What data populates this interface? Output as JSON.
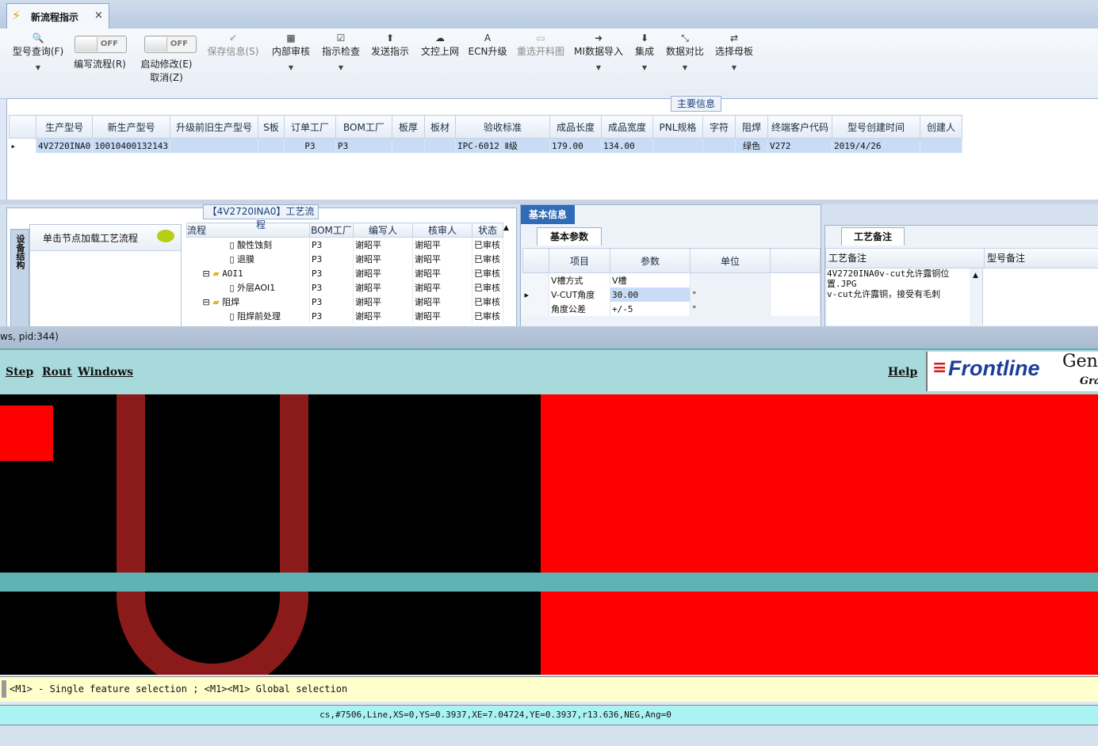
{
  "tab": {
    "title": "新流程指示",
    "close": "×"
  },
  "toolbar": {
    "query": "型号查询(F)",
    "write": "编写流程(R)",
    "start": "启动修改(E)",
    "cancel": "取消(Z)",
    "save": "保存信息(S)",
    "internal": "内部审核",
    "check": "指示检查",
    "send": "发送指示",
    "upload": "文控上网",
    "ecn": "ECN升级",
    "reselect": "重选开料图",
    "mi": "MI数据导入",
    "integrate": "集成",
    "compare": "数据对比",
    "master": "选择母板",
    "off": "OFF"
  },
  "main": {
    "group_title": "主要信息",
    "columns": [
      "生产型号",
      "新生产型号",
      "升级前旧生产型号",
      "S板",
      "订单工厂",
      "BOM工厂",
      "板厚",
      "板材",
      "验收标准",
      "成品长度",
      "成品宽度",
      "PNL规格",
      "字符",
      "阻焊",
      "终端客户代码",
      "型号创建时间",
      "创建人"
    ],
    "row": [
      "4V2720INA0",
      "10010400132143",
      "",
      "",
      "P3",
      "P3",
      "",
      "",
      "IPC-6012 Ⅱ级",
      "179.00",
      "134.00",
      "",
      "",
      "绿色",
      "V272",
      "2019/4/26",
      ""
    ]
  },
  "process": {
    "group_title": "【4V2720INA0】工艺流程",
    "side_tab": "设备结构",
    "load_text": "单击节点加载工艺流程",
    "columns": [
      "流程",
      "BOM工厂",
      "编写人",
      "核审人",
      "状态"
    ],
    "rows": [
      {
        "name": "酸性蚀刻",
        "f": "P3",
        "w": "谢昭平",
        "r": "谢昭平",
        "s": "已审核"
      },
      {
        "name": "退膜",
        "f": "P3",
        "w": "谢昭平",
        "r": "谢昭平",
        "s": "已审核"
      },
      {
        "name": "AOI1",
        "f": "P3",
        "w": "谢昭平",
        "r": "谢昭平",
        "s": "已审核"
      },
      {
        "name": "外层AOI1",
        "f": "P3",
        "w": "谢昭平",
        "r": "谢昭平",
        "s": "已审核"
      },
      {
        "name": "阻焊",
        "f": "P3",
        "w": "谢昭平",
        "r": "谢昭平",
        "s": "已审核"
      },
      {
        "name": "阻焊前处理",
        "f": "P3",
        "w": "谢昭平",
        "r": "谢昭平",
        "s": "已审核"
      }
    ]
  },
  "basic": {
    "tab": "基本信息",
    "subtab": "基本参数",
    "columns": [
      "项目",
      "参数",
      "单位"
    ],
    "rows": [
      {
        "item": "V槽方式",
        "param": "V槽",
        "unit": ""
      },
      {
        "item": "V-CUT角度",
        "param": "30.00",
        "unit": "°"
      },
      {
        "item": "角度公差",
        "param": "+/-5",
        "unit": "°"
      }
    ]
  },
  "notes": {
    "tab": "工艺备注",
    "col1": "工艺备注",
    "col2": "型号备注",
    "text1": "4V2720INA0v-cut允许露铜位置.JPG",
    "text2": "v-cut允许露铜，接受有毛刺"
  },
  "strip": {
    "pid_text": "ws, pid:344)"
  },
  "genesis": {
    "menu": [
      "Step",
      "Rout",
      "Windows"
    ],
    "help": "Help",
    "logo": "Frontline",
    "logo_side": "Gene",
    "logo_side2": "Gra",
    "prompt": "<M1> - Single feature selection ; <M1><M1> Global selection",
    "status": "cs,#7506,Line,XS=0,YS=0.3937,XE=7.04724,YE=0.3937,r13.636,NEG,Ang=0",
    "colors": {
      "copper": "#ff0000",
      "trace": "#8b1a1a",
      "cyan": "#5fb3b3"
    }
  }
}
